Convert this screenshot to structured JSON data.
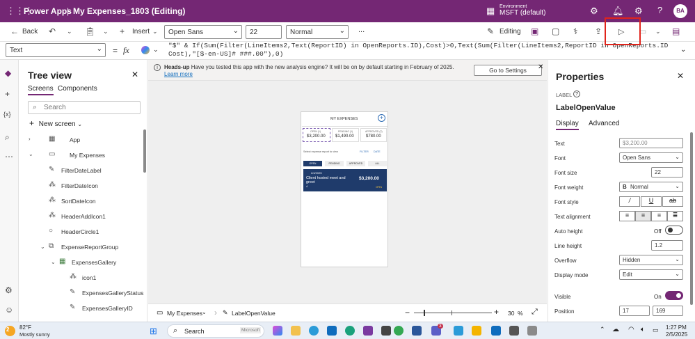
{
  "topbar": {
    "brand": "Power Apps",
    "separator": "|",
    "app_title": "My Expenses_1803 (Editing)",
    "environment_label": "Environment",
    "environment_name": "MSFT (default)",
    "avatar": "BA"
  },
  "cmdbar": {
    "back": "Back",
    "insert": "Insert",
    "font": "Open Sans",
    "font_size": "22",
    "font_weight": "Normal",
    "more": "...",
    "editing": "Editing"
  },
  "formulabar": {
    "property": "Text",
    "equals": "=",
    "fx": "fx",
    "formula": "\"$\" & If(Sum(Filter(LineItems2,Text(ReportID) in OpenReports.ID),Cost)>0,Text(Sum(Filter(LineItems2,ReportID in OpenReports.ID),\nCost),\"[$-en-US]# ###.00\"),0)"
  },
  "tree": {
    "title": "Tree view",
    "tab_screens": "Screens",
    "tab_components": "Components",
    "search_placeholder": "Search",
    "new_screen": "New screen",
    "items": [
      {
        "label": "App"
      },
      {
        "label": "My Expenses"
      },
      {
        "label": "FilterDateLabel"
      },
      {
        "label": "FilterDateIcon"
      },
      {
        "label": "SortDateIcon"
      },
      {
        "label": "HeaderAddIcon1"
      },
      {
        "label": "HeaderCircle1"
      },
      {
        "label": "ExpenseReportGroup"
      },
      {
        "label": "ExpensesGallery"
      },
      {
        "label": "icon1"
      },
      {
        "label": "ExpensesGalleryStatus"
      },
      {
        "label": "ExpensesGalleryID"
      }
    ]
  },
  "notice": {
    "title": "Heads-up",
    "text": "Have you tested this app with the new analysis engine? It will be on by default starting in February of 2025.",
    "link": "Learn more",
    "button": "Go to Settings"
  },
  "phone": {
    "header": "MY EXPENSES",
    "stat_open_label": "OPEN (1)",
    "stat_open_value": "$3,200.00",
    "stat_pending_label": "PENDING (1)",
    "stat_pending_value": "$1,490.00",
    "stat_approved_label": "APPROVED (2)",
    "stat_approved_value": "$780.00",
    "select_text": "Select expense report to view",
    "filter": "FILTER",
    "date": "DATE",
    "tabs": [
      "OPEN",
      "PENDING",
      "APPROVED",
      "ALL"
    ],
    "card_date": "2/4/2025",
    "card_title": "Client hosted meet and greet",
    "card_amount": "$3,200.00",
    "card_num": "4",
    "card_status": "OPEN"
  },
  "properties": {
    "title": "Properties",
    "type": "LABEL",
    "name": "LabelOpenValue",
    "tab_display": "Display",
    "tab_advanced": "Advanced",
    "rows": [
      {
        "label": "Text",
        "value": "$3,200.00"
      },
      {
        "label": "Font",
        "value": "Open Sans"
      },
      {
        "label": "Font size",
        "value": "22"
      },
      {
        "label": "Font weight",
        "value": "Normal"
      },
      {
        "label": "Font style",
        "value": ""
      },
      {
        "label": "Text alignment",
        "value": ""
      },
      {
        "label": "Auto height",
        "value": "Off"
      },
      {
        "label": "Line height",
        "value": "1.2"
      },
      {
        "label": "Overflow",
        "value": "Hidden"
      },
      {
        "label": "Display mode",
        "value": "Edit"
      },
      {
        "label": "Visible",
        "value": "On"
      },
      {
        "label": "Position",
        "value": "17"
      }
    ],
    "position_y": "169"
  },
  "bottombar": {
    "screen": "My Expenses",
    "control": "LabelOpenValue",
    "zoom": "30",
    "zoom_unit": "%"
  },
  "taskbar": {
    "weather_temp": "82°F",
    "weather_desc": "Mostly sunny",
    "weather_badge": "2",
    "search": "Search",
    "search_badge": "Microsoft",
    "teams_badge": "3",
    "time": "1:27 PM",
    "date": "2/5/2025"
  }
}
